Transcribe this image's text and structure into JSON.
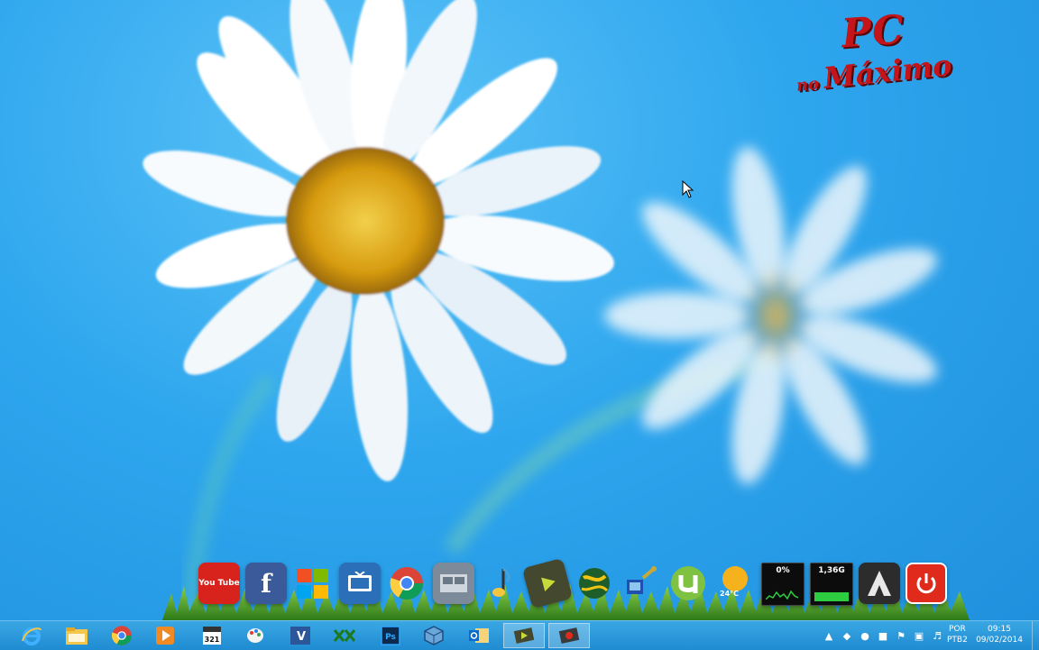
{
  "logo": {
    "line1": "PC",
    "line2_small": "no",
    "line2": "Máximo"
  },
  "dock": {
    "items": [
      {
        "name": "youtube",
        "label": "You Tube",
        "color": "#d8221c"
      },
      {
        "name": "facebook",
        "label": "f",
        "color": "#3b5a9a"
      },
      {
        "name": "windows",
        "label": "",
        "color": "#f4a21b"
      },
      {
        "name": "media-center",
        "label": "",
        "color": "#2a6fb8"
      },
      {
        "name": "chrome",
        "label": "",
        "color": "#e4e4e4"
      },
      {
        "name": "video-editor",
        "label": "",
        "color": "#7c8a99"
      },
      {
        "name": "music",
        "label": "",
        "color": "#4aa0d8"
      },
      {
        "name": "media-player",
        "label": "",
        "color": "#44482e"
      },
      {
        "name": "globe",
        "label": "",
        "color": "#1d5e2a"
      },
      {
        "name": "network",
        "label": "",
        "color": "#c7a93a"
      },
      {
        "name": "utorrent",
        "label": "",
        "color": "#7fc242"
      },
      {
        "name": "weather",
        "label": "24°C",
        "color": "#f6b21c"
      },
      {
        "name": "cpu-meter",
        "label": "0%",
        "color": "#0c0c0c"
      },
      {
        "name": "ram-meter",
        "label": "1,36G",
        "color": "#0c0c0c"
      },
      {
        "name": "assassins-creed",
        "label": "",
        "color": "#2c2c2c"
      },
      {
        "name": "shutdown",
        "label": "",
        "color": "#e02a1b"
      }
    ]
  },
  "taskbar": {
    "pinned": [
      {
        "name": "internet-explorer"
      },
      {
        "name": "file-explorer"
      },
      {
        "name": "chrome"
      },
      {
        "name": "media-player"
      },
      {
        "name": "media-player-classic",
        "label": "321"
      },
      {
        "name": "paint"
      },
      {
        "name": "visual-studio"
      },
      {
        "name": "xsplit"
      },
      {
        "name": "photoshop",
        "label": "Ps"
      },
      {
        "name": "virtualbox"
      },
      {
        "name": "outlook"
      },
      {
        "name": "media-app"
      },
      {
        "name": "recorder"
      }
    ],
    "language": {
      "line1": "POR",
      "line2": "PTB2"
    },
    "clock": {
      "time": "09:15",
      "date": "09/02/2014"
    }
  }
}
